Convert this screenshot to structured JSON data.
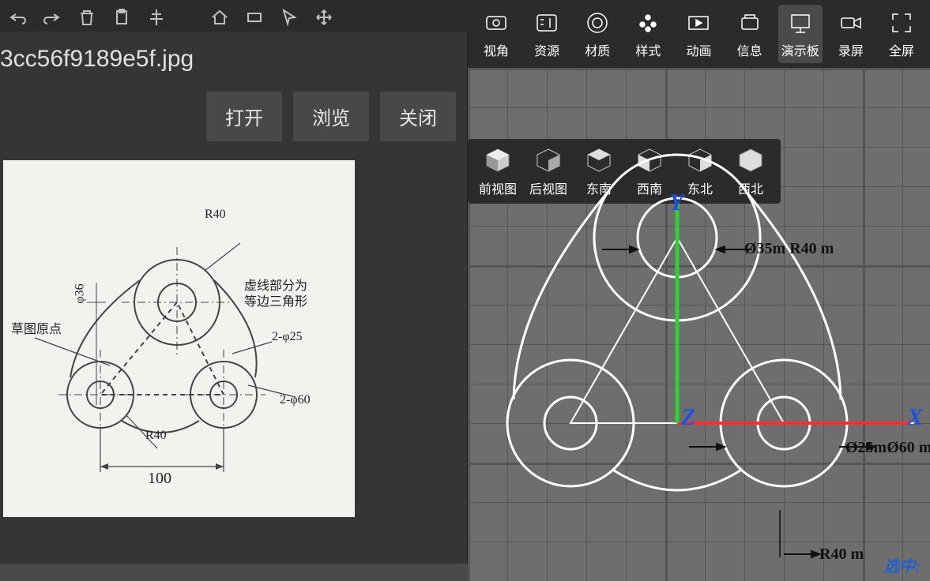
{
  "filename": "3cc56f9189e5f.jpg",
  "buttons": {
    "open": "打开",
    "browse": "浏览",
    "close": "关闭"
  },
  "blueprint": {
    "r40_top": "R40",
    "phi36": "φ36",
    "origin": "草图原点",
    "dashed_note1": "虚线部分为",
    "dashed_note2": "等边三角形",
    "two_phi25": "2-φ25",
    "r40_bottom": "R40",
    "two_phi60": "2-φ60",
    "dim100": "100"
  },
  "right_tabs": [
    {
      "key": "view",
      "label": "视角"
    },
    {
      "key": "resource",
      "label": "资源"
    },
    {
      "key": "material",
      "label": "材质"
    },
    {
      "key": "style",
      "label": "样式"
    },
    {
      "key": "animation",
      "label": "动画"
    },
    {
      "key": "info",
      "label": "信息"
    },
    {
      "key": "present",
      "label": "演示板"
    },
    {
      "key": "record",
      "label": "录屏"
    },
    {
      "key": "fullscreen",
      "label": "全屏"
    }
  ],
  "view_buttons": [
    {
      "key": "front",
      "label": "前视图"
    },
    {
      "key": "back",
      "label": "后视图"
    },
    {
      "key": "se",
      "label": "东南"
    },
    {
      "key": "sw",
      "label": "西南"
    },
    {
      "key": "ne",
      "label": "东北"
    },
    {
      "key": "nw",
      "label": "西北"
    }
  ],
  "axes": {
    "x": "X",
    "y": "Y",
    "z": "Z"
  },
  "dims": {
    "top": "Ø35m R40 m",
    "bottom": "Ø25mØ60 m",
    "r40m": "R40 m"
  },
  "corner": "选中:"
}
